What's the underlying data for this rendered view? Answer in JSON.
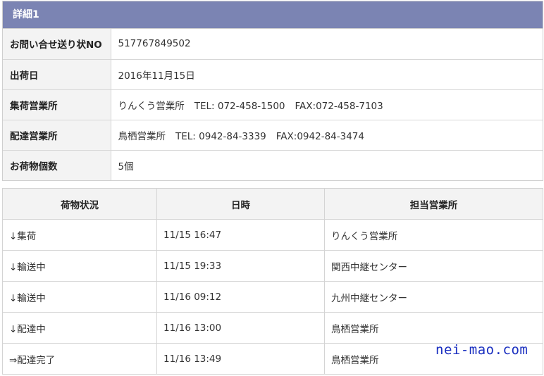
{
  "detail": {
    "header": "詳細1",
    "rows": [
      {
        "label": "お問い合せ送り状NO",
        "value": "517767849502"
      },
      {
        "label": "出荷日",
        "value": "2016年11月15日"
      },
      {
        "label": "集荷営業所",
        "office": "りんくう営業所",
        "tel": "TEL: 072-458-1500",
        "fax": "FAX:072-458-7103"
      },
      {
        "label": "配達営業所",
        "office": "鳥栖営業所",
        "tel": "TEL: 0942-84-3339",
        "fax": "FAX:0942-84-3474"
      },
      {
        "label": "お荷物個数",
        "value": "5個"
      }
    ]
  },
  "status_table": {
    "headers": [
      "荷物状況",
      "日時",
      "担当営業所"
    ],
    "rows": [
      {
        "status": "↓集荷",
        "datetime": "11/15 16:47",
        "office": "りんくう営業所"
      },
      {
        "status": "↓輸送中",
        "datetime": "11/15 19:33",
        "office": "関西中継センター"
      },
      {
        "status": "↓輸送中",
        "datetime": "11/16 09:12",
        "office": "九州中継センター"
      },
      {
        "status": "↓配達中",
        "datetime": "11/16 13:00",
        "office": "鳥栖営業所"
      },
      {
        "status": "⇒配達完了",
        "datetime": "11/16 13:49",
        "office": "鳥栖営業所"
      }
    ]
  },
  "watermark": "nei-mao.com",
  "colors": {
    "header_bg": "#7b84b3",
    "label_bg": "#f3f3f3",
    "watermark": "#1a2fc0"
  }
}
